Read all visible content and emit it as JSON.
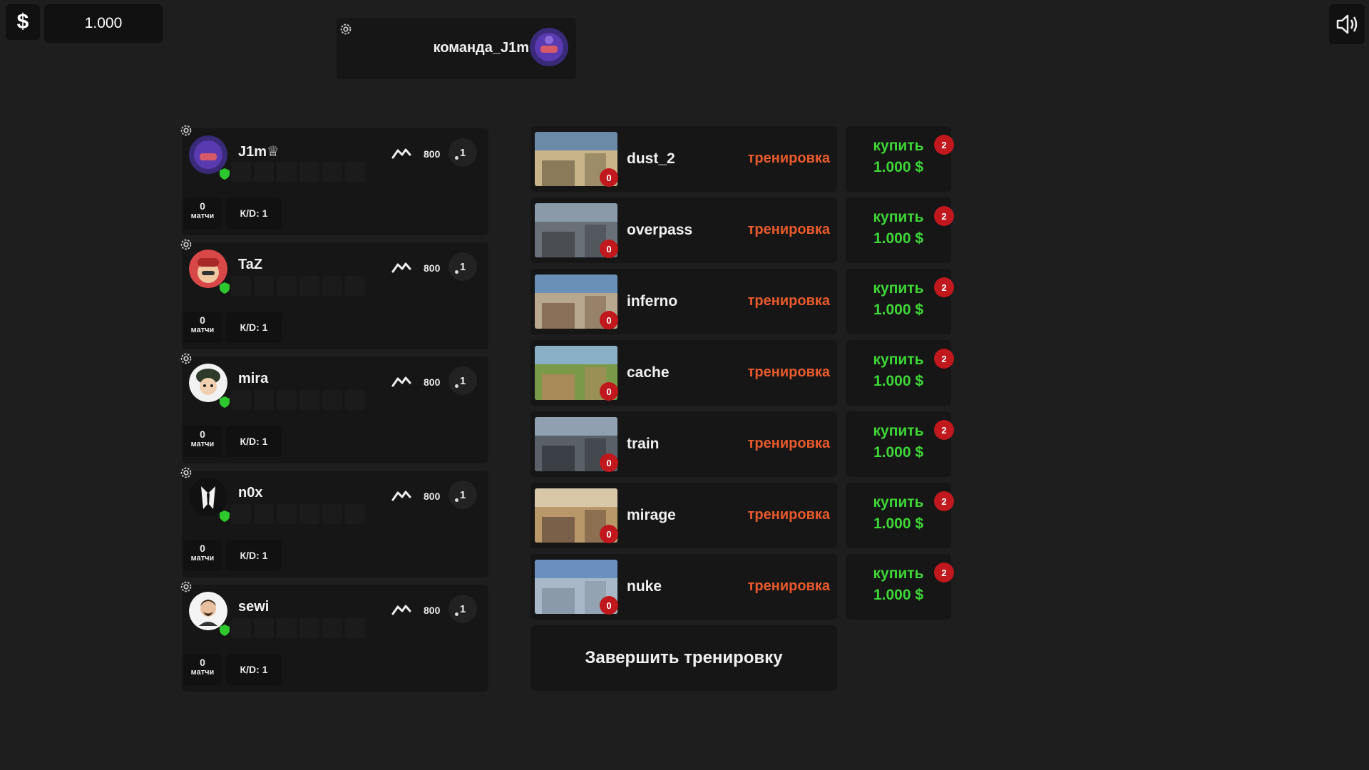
{
  "balance": {
    "currency_icon": "$",
    "amount": "1.000"
  },
  "team": {
    "name": "команда_J1m"
  },
  "players": [
    {
      "name": "J1m♕",
      "rating": "800",
      "level": "1",
      "matches": "0",
      "matches_label": "матчи",
      "kd": "К/D: 1",
      "avatar": "purple-helmet-avatar"
    },
    {
      "name": "TaZ",
      "rating": "800",
      "level": "1",
      "matches": "0",
      "matches_label": "матчи",
      "kd": "К/D: 1",
      "avatar": "red-cap-avatar"
    },
    {
      "name": "mira",
      "rating": "800",
      "level": "1",
      "matches": "0",
      "matches_label": "матчи",
      "kd": "К/D: 1",
      "avatar": "soldier-avatar"
    },
    {
      "name": "n0x",
      "rating": "800",
      "level": "1",
      "matches": "0",
      "matches_label": "матчи",
      "kd": "К/D: 1",
      "avatar": "suit-avatar"
    },
    {
      "name": "sewi",
      "rating": "800",
      "level": "1",
      "matches": "0",
      "matches_label": "матчи",
      "kd": "К/D: 1",
      "avatar": "bearded-man-avatar"
    }
  ],
  "maps": [
    {
      "name": "dust_2",
      "count": "0",
      "action": "тренировка",
      "buy_label": "купить",
      "price": "1.000 $",
      "badge": "2",
      "thumb_colors": [
        "#c9b48a",
        "#8a7a5a",
        "#6a8aa8"
      ]
    },
    {
      "name": "overpass",
      "count": "0",
      "action": "тренировка",
      "buy_label": "купить",
      "price": "1.000 $",
      "badge": "2",
      "thumb_colors": [
        "#6a7078",
        "#4a4e52",
        "#8a9aa8"
      ]
    },
    {
      "name": "inferno",
      "count": "0",
      "action": "тренировка",
      "buy_label": "купить",
      "price": "1.000 $",
      "badge": "2",
      "thumb_colors": [
        "#b8a890",
        "#8a7058",
        "#6a90b8"
      ]
    },
    {
      "name": "cache",
      "count": "0",
      "action": "тренировка",
      "buy_label": "купить",
      "price": "1.000 $",
      "badge": "2",
      "thumb_colors": [
        "#7a9a4a",
        "#a88a58",
        "#8ab0c8"
      ]
    },
    {
      "name": "train",
      "count": "0",
      "action": "тренировка",
      "buy_label": "купить",
      "price": "1.000 $",
      "badge": "2",
      "thumb_colors": [
        "#5a6068",
        "#3a4046",
        "#90a0b0"
      ]
    },
    {
      "name": "mirage",
      "count": "0",
      "action": "тренировка",
      "buy_label": "купить",
      "price": "1.000 $",
      "badge": "2",
      "thumb_colors": [
        "#b89868",
        "#7a6048",
        "#d8c8a8"
      ]
    },
    {
      "name": "nuke",
      "count": "0",
      "action": "тренировка",
      "buy_label": "купить",
      "price": "1.000 $",
      "badge": "2",
      "thumb_colors": [
        "#a8b8c8",
        "#8a9aa8",
        "#6a90c0"
      ]
    }
  ],
  "finish_label": "Завершить тренировку",
  "colors": {
    "accent_green": "#3ed636",
    "accent_orange": "#e85a2c",
    "badge_red": "#c0181c",
    "background": "#1e1e1e",
    "panel": "#161616"
  }
}
